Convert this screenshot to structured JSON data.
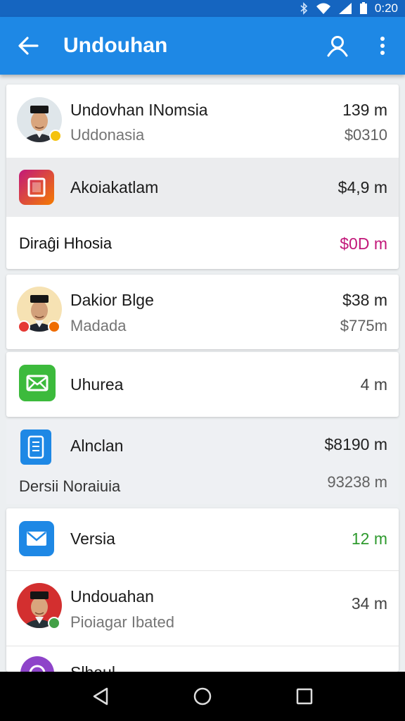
{
  "status": {
    "time": "0:20"
  },
  "appbar": {
    "title": "Undouhan"
  },
  "items": [
    {
      "name": "Undovhan INomsia",
      "sub": "Uddonasia",
      "amount": "139 m",
      "amount2": "$0310"
    },
    {
      "name": "Akoiakatlam",
      "amount": "$4,9 m"
    },
    {
      "label": "Diraĝi Hhosia",
      "amount": "$0D m",
      "amount_color": "#c2187a"
    },
    {
      "name": "Dakior Blge",
      "sub": "Madada",
      "amount": "$38 m",
      "amount2": "$775m"
    },
    {
      "name": "Uhurea",
      "amount": "4 m"
    },
    {
      "name": "Alnclan",
      "amount": "$8190 m",
      "label": "Dersii Noraiuia",
      "amount2": "93238 m"
    },
    {
      "name": "Versia",
      "amount": "12 m",
      "amount_color": "#2e9a2e"
    },
    {
      "name": "Undouahan",
      "sub": "Pioiagar Ibated",
      "amount": "34 m"
    },
    {
      "name": "Slhaul"
    }
  ],
  "icons": {
    "back": "arrow-left-icon",
    "account": "person-icon",
    "menu": "more-vert-icon",
    "nav_back": "triangle-back-icon",
    "nav_home": "circle-home-icon",
    "nav_recent": "square-recents-icon"
  },
  "colors": {
    "appbar": "#1e88e5",
    "statusbar": "#1565c0",
    "accent_pink": "#c2187a",
    "accent_green": "#2e9a2e"
  }
}
